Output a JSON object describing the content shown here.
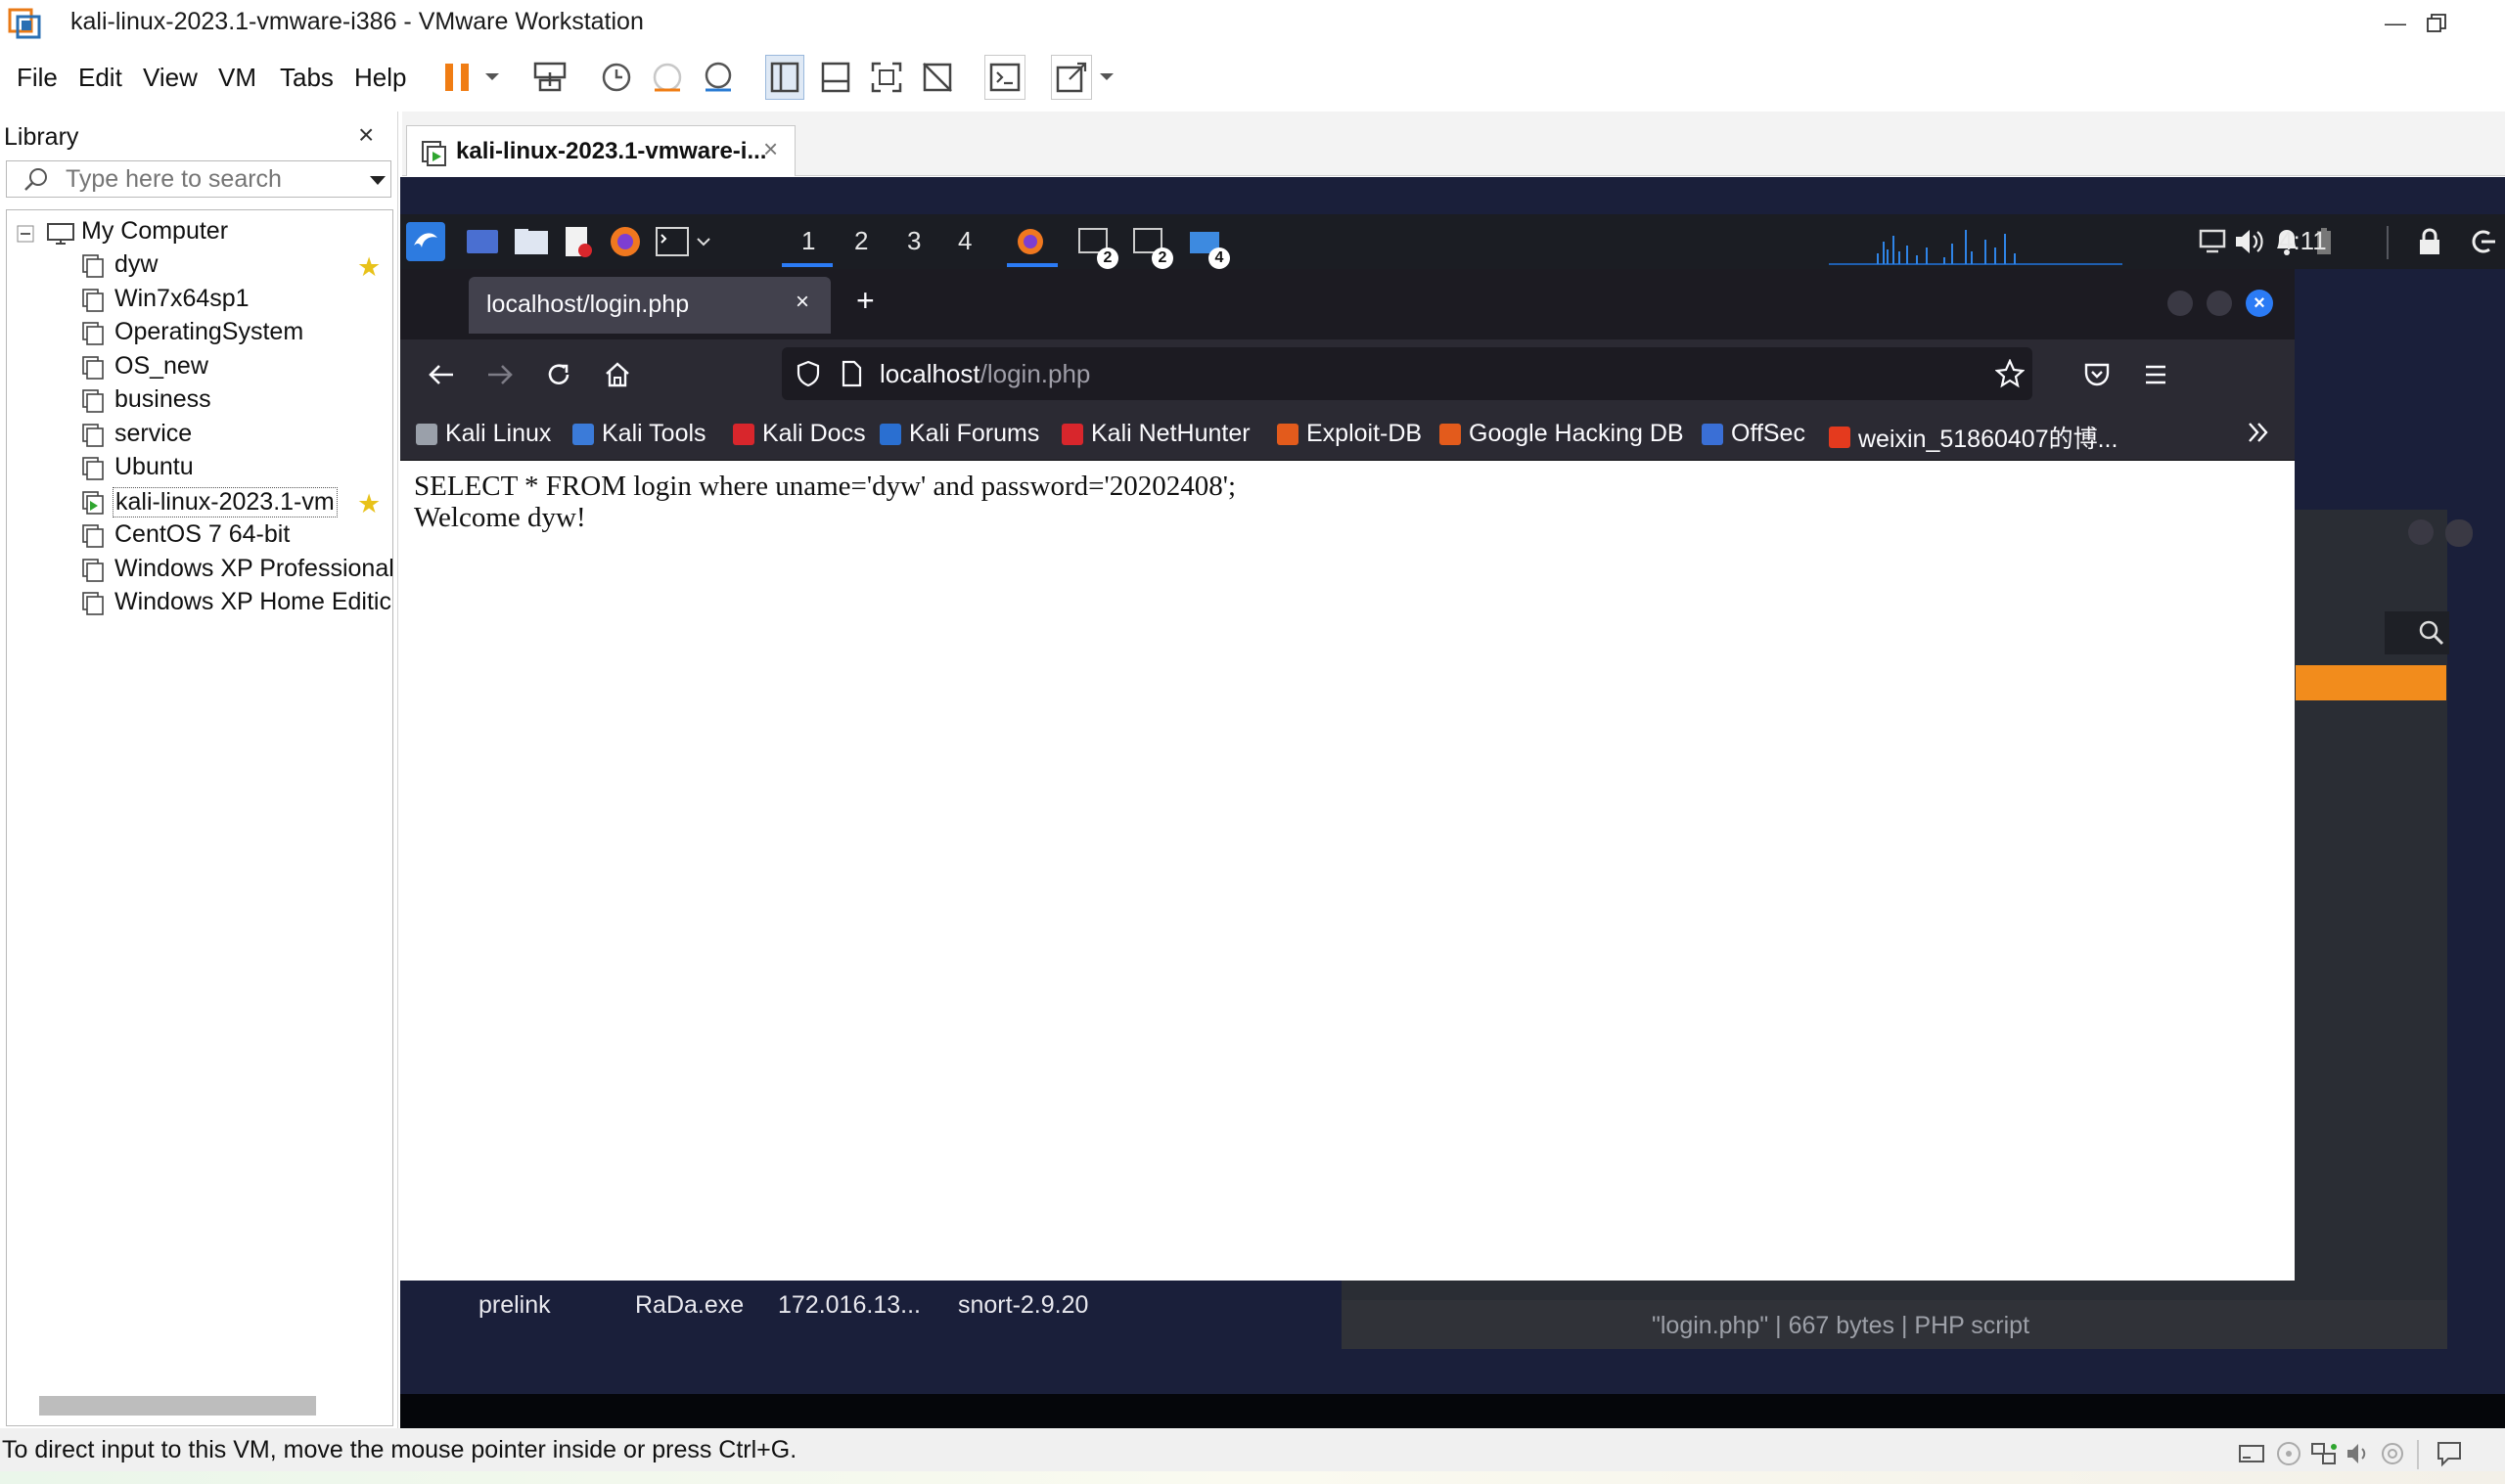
{
  "window": {
    "title": "kali-linux-2023.1-vmware-i386 - VMware Workstation",
    "minimize_icon": "minimize-icon",
    "restore_icon": "restore-icon"
  },
  "menu": {
    "items": [
      "File",
      "Edit",
      "View",
      "VM",
      "Tabs",
      "Help"
    ]
  },
  "toolbar": {
    "icons": [
      "pause-icon",
      "dropdown-icon",
      "send-keys-icon",
      "snapshot-icon",
      "revert-snapshot-icon",
      "snapshot-manager-icon",
      "show-library-icon",
      "thumbnail-bar-icon",
      "fullscreen-icon",
      "unity-icon",
      "console-icon",
      "stretch-icon",
      "dropdown-icon"
    ]
  },
  "library": {
    "title": "Library",
    "close": "×",
    "search_placeholder": "Type here to search",
    "root": "My Computer",
    "vms": [
      {
        "name": "dyw",
        "starred": true,
        "running": false
      },
      {
        "name": "Win7x64sp1",
        "starred": false,
        "running": false
      },
      {
        "name": "OperatingSystem",
        "starred": false,
        "running": false
      },
      {
        "name": "OS_new",
        "starred": false,
        "running": false
      },
      {
        "name": "business",
        "starred": false,
        "running": false
      },
      {
        "name": "service",
        "starred": false,
        "running": false
      },
      {
        "name": "Ubuntu",
        "starred": false,
        "running": false
      },
      {
        "name": "kali-linux-2023.1-vm",
        "starred": true,
        "running": true
      },
      {
        "name": "CentOS 7 64-bit",
        "starred": false,
        "running": false
      },
      {
        "name": "Windows XP Professional",
        "starred": false,
        "running": false
      },
      {
        "name": "Windows XP Home Editic",
        "starred": false,
        "running": false
      }
    ]
  },
  "vm_tab": {
    "label": "kali-linux-2023.1-vmware-i...",
    "close": "×"
  },
  "kali_panel": {
    "workspaces": [
      "1",
      "2",
      "3",
      "4"
    ],
    "badges": [
      "2",
      "2",
      "4"
    ],
    "clock": "4:11"
  },
  "firefox": {
    "tab_title": "localhost/login.php",
    "tab_close": "×",
    "new_tab": "+",
    "url_host": "localhost",
    "url_path": "/login.php",
    "bookmarks": [
      {
        "label": "Kali Linux",
        "color": "#9aa0aa"
      },
      {
        "label": "Kali Tools",
        "color": "#3b7bd9"
      },
      {
        "label": "Kali Docs",
        "color": "#d8262c"
      },
      {
        "label": "Kali Forums",
        "color": "#2a6fd1"
      },
      {
        "label": "Kali NetHunter",
        "color": "#d8262c"
      },
      {
        "label": "Exploit-DB",
        "color": "#e35b1c"
      },
      {
        "label": "Google Hacking DB",
        "color": "#e35b1c"
      },
      {
        "label": "OffSec",
        "color": "#3a6fd6"
      },
      {
        "label": "weixin_51860407的博...",
        "color": "#e43a1e"
      }
    ],
    "page_lines": [
      "SELECT * FROM login where uname='dyw' and password='20202408';",
      "Welcome dyw!"
    ]
  },
  "desktop_behind": {
    "labels": [
      "prelink",
      "RaDa.exe",
      "172.016.13...",
      "snort-2.9.20"
    ],
    "fm_status": "\"login.php\" | 667 bytes | PHP script"
  },
  "statusbar": {
    "text": "To direct input to this VM, move the mouse pointer inside or press Ctrl+G."
  },
  "colors": {
    "accent": "#2b7bf5",
    "pause": "#f07d14",
    "kali_desktop": "#1a1f3a",
    "firefox_chrome": "#2b2a33"
  }
}
